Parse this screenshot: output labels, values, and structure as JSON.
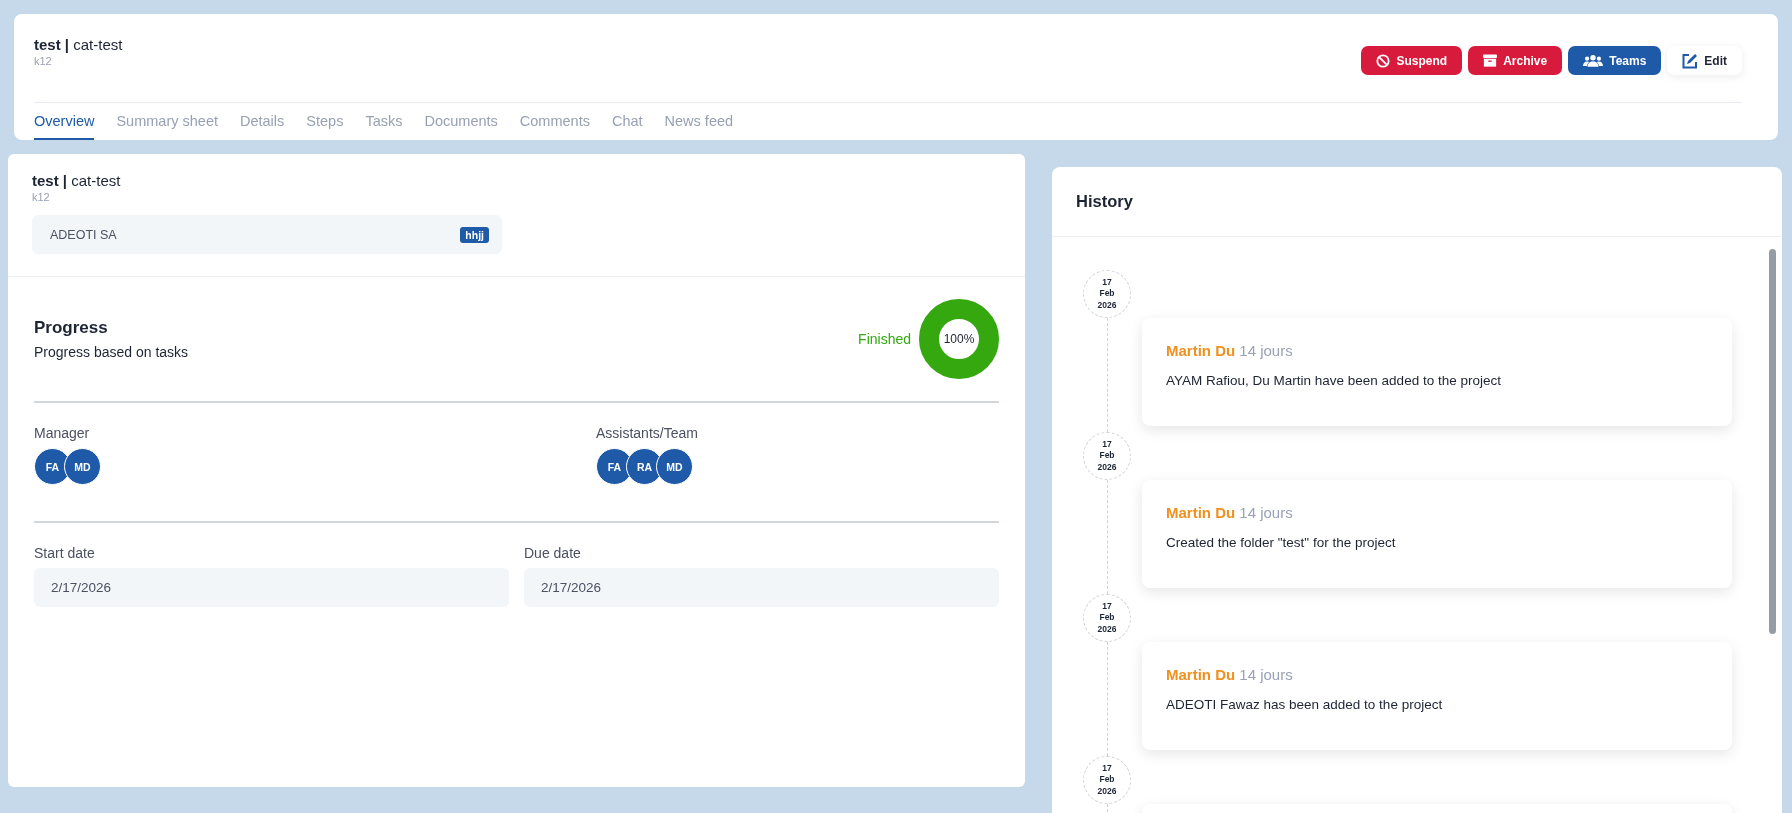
{
  "header": {
    "title_bold": "test |",
    "title": "cat-test",
    "code": "k12",
    "actions": [
      {
        "label": "Suspend",
        "kind": "suspend"
      },
      {
        "label": "Archive",
        "kind": "archive"
      },
      {
        "label": "Teams",
        "kind": "teams"
      },
      {
        "label": "Edit",
        "kind": "edit"
      }
    ],
    "tabs": [
      {
        "label": "Overview",
        "selected": true
      },
      {
        "label": "Summary sheet",
        "selected": false
      },
      {
        "label": "Details",
        "selected": false
      },
      {
        "label": "Steps",
        "selected": false
      },
      {
        "label": "Tasks",
        "selected": false
      },
      {
        "label": "Documents",
        "selected": false
      },
      {
        "label": "Comments",
        "selected": false
      },
      {
        "label": "Chat",
        "selected": false
      },
      {
        "label": "News feed",
        "selected": false
      }
    ]
  },
  "overview": {
    "title_bold": "test |",
    "title": "cat-test",
    "code": "k12",
    "client": "ADEOTI SA",
    "client_tag": "hhjj",
    "progress": {
      "heading": "Progress",
      "subtitle": "Progress based on tasks",
      "status": "Finished",
      "level": 1,
      "reading": "100%"
    },
    "manager": {
      "label": "Manager",
      "members": [
        "FA",
        "MD"
      ]
    },
    "team": {
      "label": "Assistants/Team",
      "members": [
        "FA",
        "RA",
        "MD"
      ]
    },
    "start_date": {
      "label": "Start date",
      "value": "2/17/2026"
    },
    "due_date": {
      "label": "Due date",
      "value": "2/17/2026"
    }
  },
  "history": {
    "title": "History",
    "items": [
      {
        "date": "17 Feb 2026",
        "author": "Martin Du",
        "ago": "14 jours",
        "text": "AYAM Rafiou, Du Martin have been added to the project"
      },
      {
        "date": "17 Feb 2026",
        "author": "Martin Du",
        "ago": "14 jours",
        "text": "Created the folder \"test\" for the project"
      },
      {
        "date": "17 Feb 2026",
        "author": "Martin Du",
        "ago": "14 jours",
        "text": "ADEOTI Fawaz has been added to the project"
      },
      {
        "date": "17 Feb 2026"
      }
    ]
  }
}
